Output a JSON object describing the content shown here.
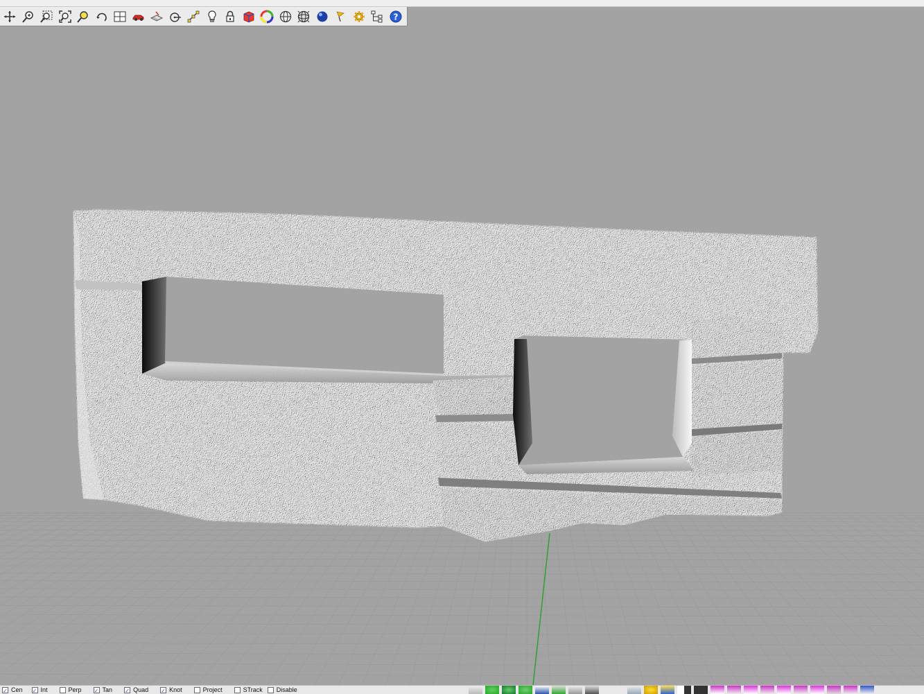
{
  "toolbar": {
    "tools": [
      {
        "name": "pan-icon"
      },
      {
        "name": "zoom-icon"
      },
      {
        "name": "zoom-window-icon"
      },
      {
        "name": "zoom-extents-icon"
      },
      {
        "name": "zoom-selected-icon"
      },
      {
        "name": "rotate-view-icon"
      },
      {
        "name": "four-viewports-icon"
      },
      {
        "name": "car-icon"
      },
      {
        "name": "layer-plane-icon"
      },
      {
        "name": "target-icon"
      },
      {
        "name": "snap-points-icon"
      },
      {
        "name": "light-bulb-icon"
      },
      {
        "name": "lock-icon"
      },
      {
        "name": "render-book-icon"
      },
      {
        "name": "color-wheel-icon"
      },
      {
        "name": "sphere-wireframe-icon"
      },
      {
        "name": "sphere-grid-icon"
      },
      {
        "name": "blue-sphere-icon"
      },
      {
        "name": "flag-icon"
      },
      {
        "name": "gear-icon"
      },
      {
        "name": "hierarchy-icon"
      },
      {
        "name": "help-icon"
      }
    ]
  },
  "colors": {
    "viewport_bg": "#a3a3a3",
    "grid_line": "#9a9a9a",
    "axis_green": "#2fa12f",
    "model_surface": "#f2f2f2"
  },
  "status_bar": {
    "osnaps": [
      {
        "label": "Cen",
        "checked": true
      },
      {
        "label": "Int",
        "checked": true
      },
      {
        "label": "Perp",
        "checked": false
      },
      {
        "label": "Tan",
        "checked": true
      },
      {
        "label": "Quad",
        "checked": true
      },
      {
        "label": "Knot",
        "checked": true
      },
      {
        "label": "Project",
        "checked": false
      },
      {
        "label": "STrack",
        "checked": false
      },
      {
        "label": "Disable",
        "checked": false
      }
    ],
    "checkmark": "✓"
  },
  "viewport": {
    "model": "scanned-wall-mesh"
  }
}
